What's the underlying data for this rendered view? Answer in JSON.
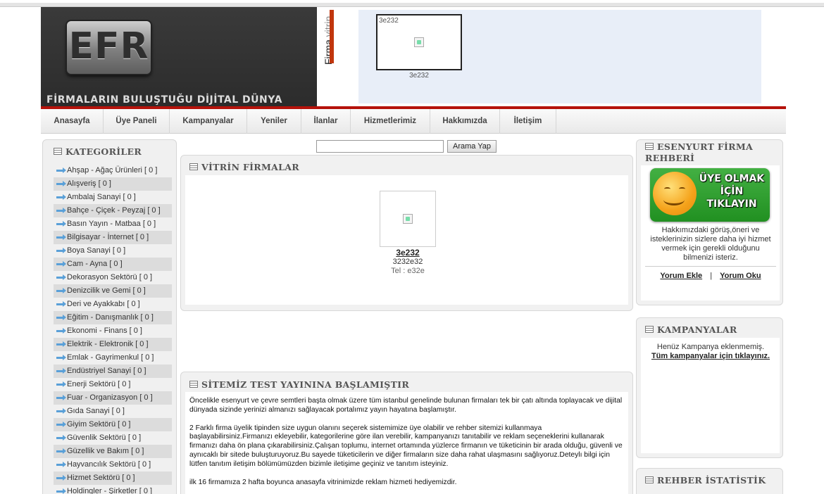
{
  "header": {
    "logo_text": "EFR",
    "tagline": "FİRMALARIN BULUŞTUĞU DİJİTAL DÜNYA",
    "vitrin_label_dark": "Firma",
    "vitrin_label_light": "vitrin",
    "banner_alt": "3e232",
    "banner_caption": "3e232"
  },
  "nav": {
    "items": [
      "Anasayfa",
      "Üye Paneli",
      "Kampanyalar",
      "Yeniler",
      "İlanlar",
      "Hizmetlerimiz",
      "Hakkımızda",
      "İletişim"
    ]
  },
  "search": {
    "value": "",
    "button_label": "Arama Yap"
  },
  "categories": {
    "title": "KATEGORİLER",
    "items": [
      "Ahşap - Ağaç Ürünleri  [ 0 ]",
      "Alışveriş  [ 0 ]",
      "Ambalaj Sanayi  [ 0 ]",
      "Bahçe - Çiçek - Peyzaj  [ 0 ]",
      "Basın Yayın - Matbaa  [ 0 ]",
      "Bilgisayar - İnternet  [ 0 ]",
      "Boya Sanayi  [ 0 ]",
      "Cam - Ayna  [ 0 ]",
      "Dekorasyon Sektörü  [ 0 ]",
      "Denizcilik ve Gemi  [ 0 ]",
      "Deri ve Ayakkabı  [ 0 ]",
      "Eğitim - Danışmanlık  [ 0 ]",
      "Ekonomi - Finans  [ 0 ]",
      "Elektrik - Elektronik  [ 0 ]",
      "Emlak - Gayrimenkul  [ 0 ]",
      "Endüstriyel Sanayi  [ 0 ]",
      "Enerji Sektörü  [ 0 ]",
      "Fuar - Organizasyon  [ 0 ]",
      "Gıda Sanayi  [ 0 ]",
      "Giyim Sektörü  [ 0 ]",
      "Güvenlik Sektörü  [ 0 ]",
      "Güzellik ve Bakım  [ 0 ]",
      "Hayvancılık Sektörü  [ 0 ]",
      "Hizmet Sektörü  [ 0 ]",
      "Holdingler - Şirketler  [ 0 ]"
    ]
  },
  "vitrin": {
    "title": "VİTRİN FİRMALAR",
    "firm_name": "3e232",
    "firm_line": "3232e32",
    "firm_tel": "Tel : e32e"
  },
  "announcement": {
    "title": "SİTEMİZ TEST YAYININA BAŞLAMIŞTIR",
    "p1": "Öncelikle esenyurt ve çevre semtleri başta olmak üzere tüm istanbul genelinde bulunan firmaları tek bir çatı altında toplayacak ve dijital dünyada sizinde yerinizi almanızı sağlayacak portalımız yayın hayatına başlamıştır.",
    "p2": "2 Farklı firma üyelik tipinden size uygun olanını seçerek sistemimize üye olabilir ve rehber sitemizi kullanmaya başlayabilirsiniz.Firmanızı ekleyebilir, kategorilerine göre ilan verebilir, kampanyanızı tanıtabilir ve reklam seçeneklerini kullanarak firmanızı daha ön plana çıkarabilirsiniz.Çalışan toplumu, internet ortamında yüzlerce firmanın ve tüketicinin bir arada olduğu, güvenli ve aynıcaklı bir sitede buluşturuyoruz.Bu sayede tüketicilerin ve diğer firmaların size daha rahat ulaşmasını sağlıyoruz.Deteylı bilgi için lütfen tanıtım iletişim bölümümüzden bizimle iletişime geçiniz ve tanıtım isteyiniz.",
    "p3": "ilk 16 firmamıza 2 hafta boyunca anasayfa vitrinimizde reklam hizmeti hediyemizdir."
  },
  "rehber": {
    "title_line1": "ESENYURT FİRMA",
    "title_line2": "REHBERİ",
    "join_line1": "ÜYE OLMAK",
    "join_line2": "İÇİN",
    "join_line3": "TIKLAYIN",
    "text": "Hakkımızdaki görüş,öneri ve isteklerinizin sizlere daha iyi hizmet vermek için gerekli olduğunu bilmenizi isteriz.",
    "link_add": "Yorum Ekle",
    "separator": "|",
    "link_read": "Yorum Oku"
  },
  "kampanyalar": {
    "title": "KAMPANYALAR",
    "text": "Henüz Kampanya eklenmemiş.",
    "link": "Tüm kampanyalar için tıklayınız."
  },
  "istatistik": {
    "title": "REHBER İSTATİSTİK"
  }
}
